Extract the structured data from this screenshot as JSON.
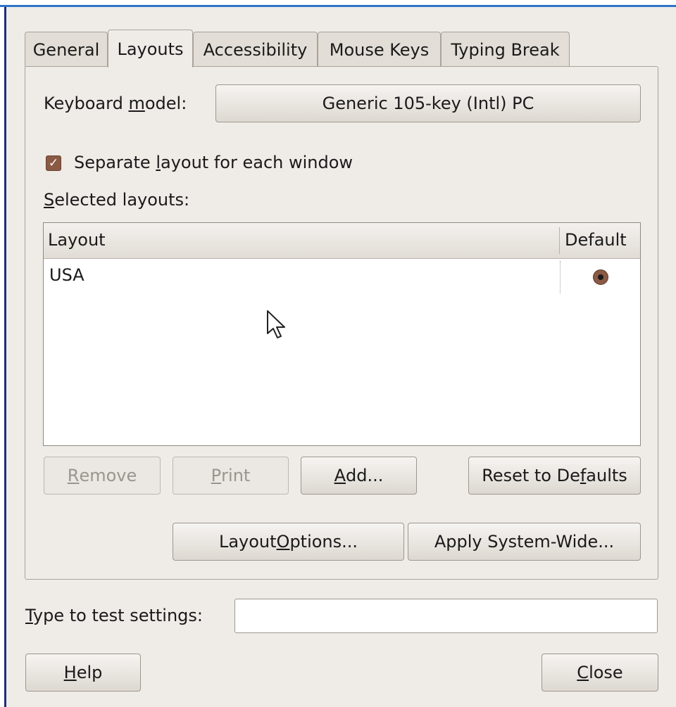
{
  "tabs": [
    {
      "label": "General"
    },
    {
      "label": "Layouts",
      "active": true
    },
    {
      "label": "Accessibility"
    },
    {
      "label": "Mouse Keys"
    },
    {
      "label": "Typing Break"
    }
  ],
  "keyboard_model": {
    "label_pre": "Keyboard ",
    "label_mn": "m",
    "label_post": "odel:",
    "value": "Generic 105-key (Intl) PC"
  },
  "separate_layout": {
    "checked": true,
    "label_pre": "Separate ",
    "label_mn": "l",
    "label_post": "ayout for each window"
  },
  "selected_layouts": {
    "label_mn": "S",
    "label_post": "elected layouts:"
  },
  "layout_table": {
    "columns": [
      "Layout",
      "Default"
    ],
    "rows": [
      {
        "layout": "USA",
        "default": true
      }
    ]
  },
  "buttons": {
    "remove": {
      "mn": "R",
      "rest": "emove",
      "enabled": false
    },
    "print": {
      "mn": "P",
      "rest": "rint",
      "enabled": false
    },
    "add": {
      "mn": "A",
      "rest": "dd...",
      "enabled": true
    },
    "reset": {
      "pre": "Reset to De",
      "mn": "f",
      "post": "aults"
    },
    "layout_options": {
      "pre": "Layout ",
      "mn": "O",
      "post": "ptions..."
    },
    "apply_system_wide": {
      "label": "Apply System-Wide..."
    },
    "help": {
      "mn": "H",
      "rest": "elp"
    },
    "close": {
      "mn": "C",
      "rest": "lose"
    }
  },
  "test_settings": {
    "label_mn": "T",
    "label_post": "ype to test settings:",
    "value": ""
  },
  "colors": {
    "window_bg": "#efebe7",
    "accent_brown": "#8a5a44",
    "frame_blue": "#2f74c8"
  }
}
